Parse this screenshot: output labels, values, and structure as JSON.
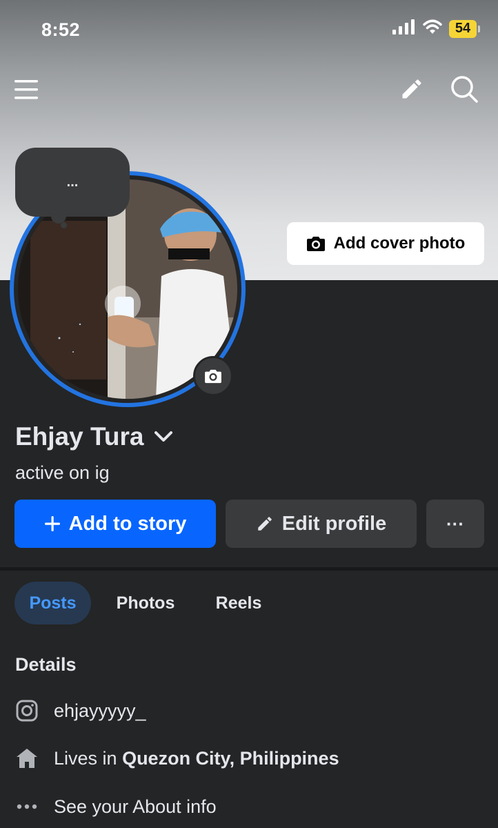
{
  "status_bar": {
    "time": "8:52",
    "battery": "54"
  },
  "cover": {
    "add_cover_label": "Add cover photo"
  },
  "note": {
    "text": "..."
  },
  "profile": {
    "name": "Ehjay Tura",
    "bio": "active on ig"
  },
  "actions": {
    "add_story_label": "Add to story",
    "edit_profile_label": "Edit profile",
    "more_label": "···"
  },
  "tabs": [
    {
      "label": "Posts",
      "active": true
    },
    {
      "label": "Photos",
      "active": false
    },
    {
      "label": "Reels",
      "active": false
    }
  ],
  "details": {
    "title": "Details",
    "instagram": "ehjayyyyy_",
    "lives_prefix": "Lives in ",
    "lives_place": "Quezon City, Philippines",
    "about": "See your About info"
  },
  "colors": {
    "accent": "#0866ff",
    "ring": "#2374e1",
    "background": "#242526",
    "tab_active_bg": "#263951",
    "tab_active_text": "#4599ff"
  },
  "icons": [
    "signal-icon",
    "wifi-icon",
    "battery-icon",
    "menu-icon",
    "pencil-icon",
    "search-icon",
    "camera-icon",
    "chevron-down-icon",
    "plus-icon",
    "instagram-icon",
    "home-icon",
    "dots-icon"
  ]
}
